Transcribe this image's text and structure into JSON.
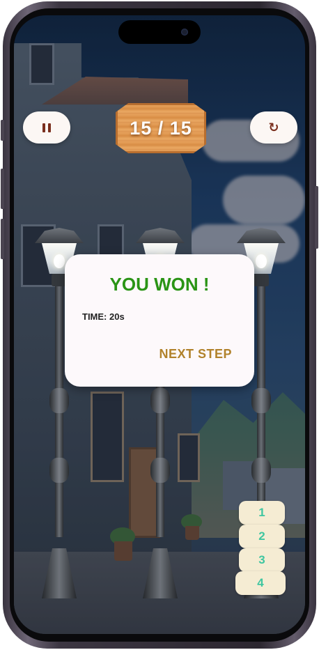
{
  "game": {
    "level_display": "15 / 15",
    "pause_icon": "pause-icon",
    "restart_icon": "restart-icon",
    "restart_glyph": "↻"
  },
  "win_dialog": {
    "title": "YOU WON !",
    "time_label": "TIME: 20s",
    "next_button_label": "NEXT STEP"
  },
  "number_buttons": [
    "1",
    "2",
    "3",
    "4"
  ],
  "colors": {
    "win_title": "#2a9415",
    "next_button": "#b1822b",
    "number_text": "#3fc6a0",
    "plank": "#e0984f"
  }
}
